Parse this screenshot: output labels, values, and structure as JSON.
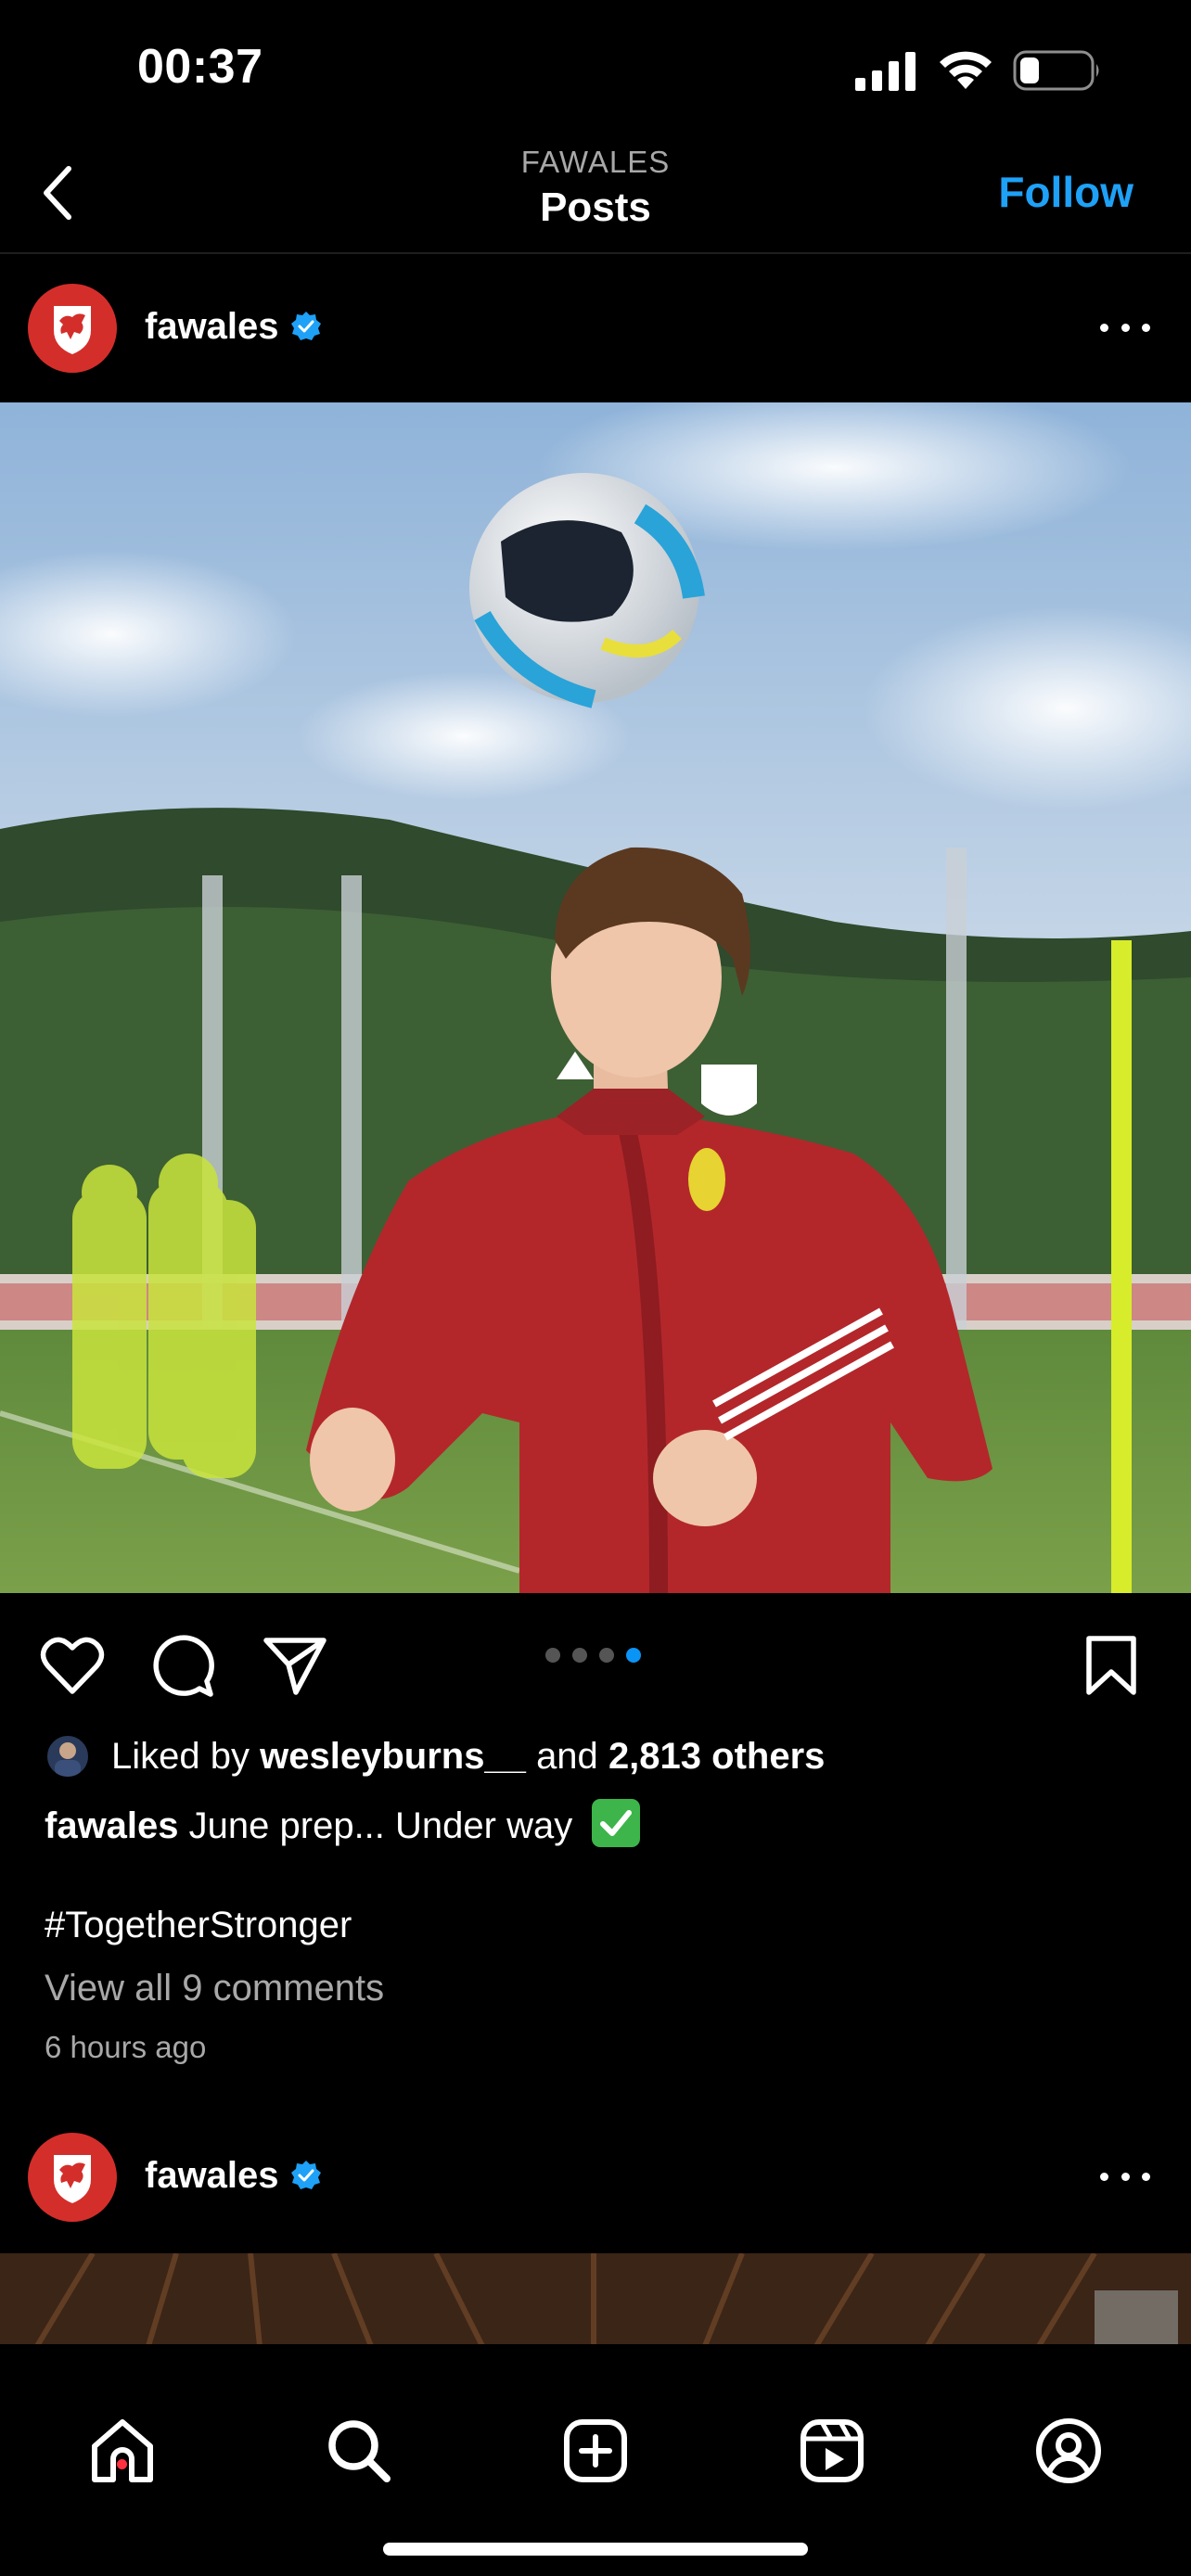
{
  "status_bar": {
    "time": "00:37"
  },
  "header": {
    "subtitle": "FAWALES",
    "title": "Posts",
    "follow_label": "Follow"
  },
  "post": {
    "username": "fawales",
    "liked_by_prefix": "Liked by",
    "liked_by_user": "wesleyburns__",
    "liked_by_and": "and",
    "liked_by_others": "2,813 others",
    "caption_user": "fawales",
    "caption_text": "June prep... Under way",
    "hashtag": "#TogetherStronger",
    "view_comments": "View all 9 comments",
    "time_ago": "6 hours ago",
    "carousel": {
      "total": 4,
      "active": 4
    }
  },
  "next_post": {
    "username": "fawales"
  },
  "icons": {
    "back": "chevron-left-icon",
    "verified": "verified-badge-icon",
    "more": "more-horizontal-icon",
    "like": "heart-icon",
    "comment": "comment-icon",
    "share": "send-icon",
    "save": "bookmark-icon",
    "home": "home-icon",
    "search": "search-icon",
    "create": "plus-square-icon",
    "reels": "reels-icon",
    "profile": "profile-icon"
  },
  "colors": {
    "accent": "#1ea1f7",
    "verified": "#1ea1f7",
    "carousel_active": "#0a95f6",
    "notification_dot": "#ff3040",
    "background": "#000000"
  }
}
